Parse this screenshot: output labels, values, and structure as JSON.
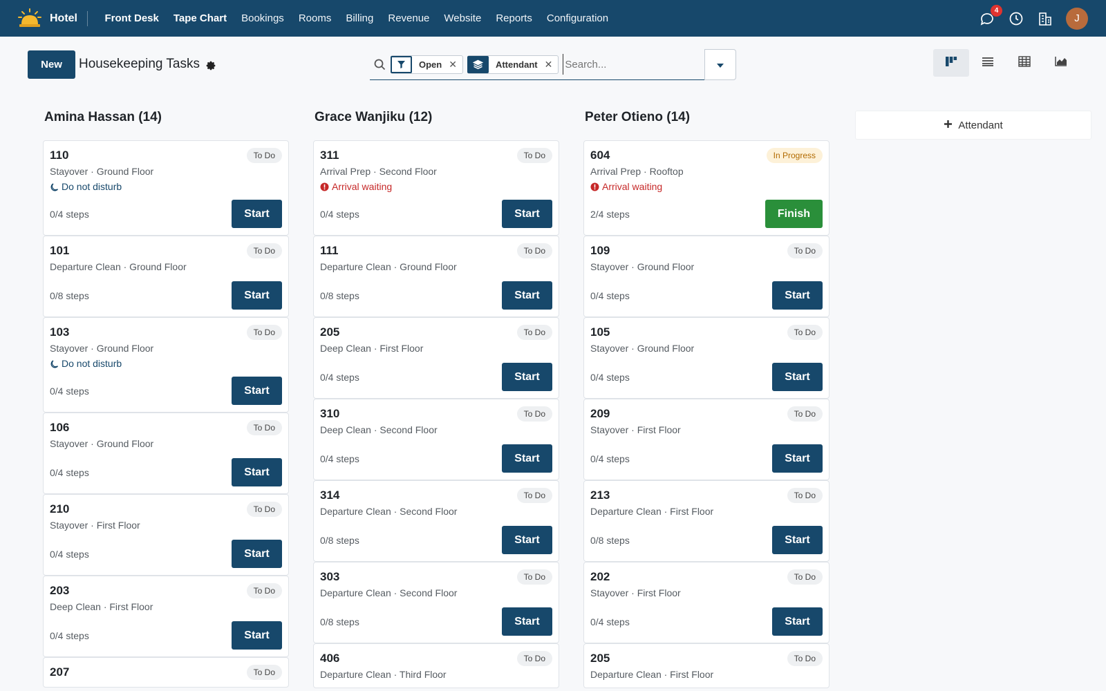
{
  "app": {
    "name": "Hotel"
  },
  "nav": {
    "items": [
      {
        "label": "Front Desk",
        "strong": true
      },
      {
        "label": "Tape Chart",
        "strong": true
      },
      {
        "label": "Bookings"
      },
      {
        "label": "Rooms"
      },
      {
        "label": "Billing"
      },
      {
        "label": "Revenue"
      },
      {
        "label": "Website"
      },
      {
        "label": "Reports"
      },
      {
        "label": "Configuration"
      }
    ],
    "messages_badge": "4",
    "avatar_initial": "J"
  },
  "control": {
    "new_label": "New",
    "title": "Housekeeping Tasks",
    "facets": [
      {
        "label": "Open",
        "icon": "filter-icon"
      },
      {
        "label": "Attendant",
        "icon": "layers-icon"
      }
    ],
    "search_placeholder": "Search..."
  },
  "columns": [
    {
      "title": "Amina Hassan (14)",
      "cards": [
        {
          "room": "110",
          "sub": "Stayover · Ground Floor",
          "status": "To Do",
          "note": "Do not disturb",
          "note_type": "dnd",
          "steps": "0/4 steps",
          "action": "Start"
        },
        {
          "room": "101",
          "sub": "Departure Clean · Ground Floor",
          "status": "To Do",
          "steps": "0/8 steps",
          "action": "Start"
        },
        {
          "room": "103",
          "sub": "Stayover · Ground Floor",
          "status": "To Do",
          "note": "Do not disturb",
          "note_type": "dnd",
          "steps": "0/4 steps",
          "action": "Start"
        },
        {
          "room": "106",
          "sub": "Stayover · Ground Floor",
          "status": "To Do",
          "steps": "0/4 steps",
          "action": "Start"
        },
        {
          "room": "210",
          "sub": "Stayover · First Floor",
          "status": "To Do",
          "steps": "0/4 steps",
          "action": "Start"
        },
        {
          "room": "203",
          "sub": "Deep Clean · First Floor",
          "status": "To Do",
          "steps": "0/4 steps",
          "action": "Start"
        },
        {
          "room": "207",
          "sub": "",
          "status": "To Do",
          "steps": "",
          "action": ""
        }
      ]
    },
    {
      "title": "Grace Wanjiku (12)",
      "cards": [
        {
          "room": "311",
          "sub": "Arrival Prep · Second Floor",
          "status": "To Do",
          "note": "Arrival waiting",
          "note_type": "warn",
          "steps": "0/4 steps",
          "action": "Start"
        },
        {
          "room": "111",
          "sub": "Departure Clean · Ground Floor",
          "status": "To Do",
          "steps": "0/8 steps",
          "action": "Start"
        },
        {
          "room": "205",
          "sub": "Deep Clean · First Floor",
          "status": "To Do",
          "steps": "0/4 steps",
          "action": "Start"
        },
        {
          "room": "310",
          "sub": "Deep Clean · Second Floor",
          "status": "To Do",
          "steps": "0/4 steps",
          "action": "Start"
        },
        {
          "room": "314",
          "sub": "Departure Clean · Second Floor",
          "status": "To Do",
          "steps": "0/8 steps",
          "action": "Start"
        },
        {
          "room": "303",
          "sub": "Departure Clean · Second Floor",
          "status": "To Do",
          "steps": "0/8 steps",
          "action": "Start"
        },
        {
          "room": "406",
          "sub": "Departure Clean · Third Floor",
          "status": "To Do",
          "steps": "",
          "action": ""
        }
      ]
    },
    {
      "title": "Peter Otieno (14)",
      "cards": [
        {
          "room": "604",
          "sub": "Arrival Prep · Rooftop",
          "status": "In Progress",
          "note": "Arrival waiting",
          "note_type": "warn",
          "steps": "2/4 steps",
          "action": "Finish"
        },
        {
          "room": "109",
          "sub": "Stayover · Ground Floor",
          "status": "To Do",
          "steps": "0/4 steps",
          "action": "Start"
        },
        {
          "room": "105",
          "sub": "Stayover · Ground Floor",
          "status": "To Do",
          "steps": "0/4 steps",
          "action": "Start"
        },
        {
          "room": "209",
          "sub": "Stayover · First Floor",
          "status": "To Do",
          "steps": "0/4 steps",
          "action": "Start"
        },
        {
          "room": "213",
          "sub": "Departure Clean · First Floor",
          "status": "To Do",
          "steps": "0/8 steps",
          "action": "Start"
        },
        {
          "room": "202",
          "sub": "Stayover · First Floor",
          "status": "To Do",
          "steps": "0/4 steps",
          "action": "Start"
        },
        {
          "room": "205",
          "sub": "Departure Clean · First Floor",
          "status": "To Do",
          "steps": "",
          "action": ""
        }
      ]
    }
  ],
  "add_column_label": "Attendant",
  "colors": {
    "primary": "#17486b",
    "finish": "#2a8f3a",
    "warning": "#c62828",
    "in_progress": "#b26a00"
  }
}
